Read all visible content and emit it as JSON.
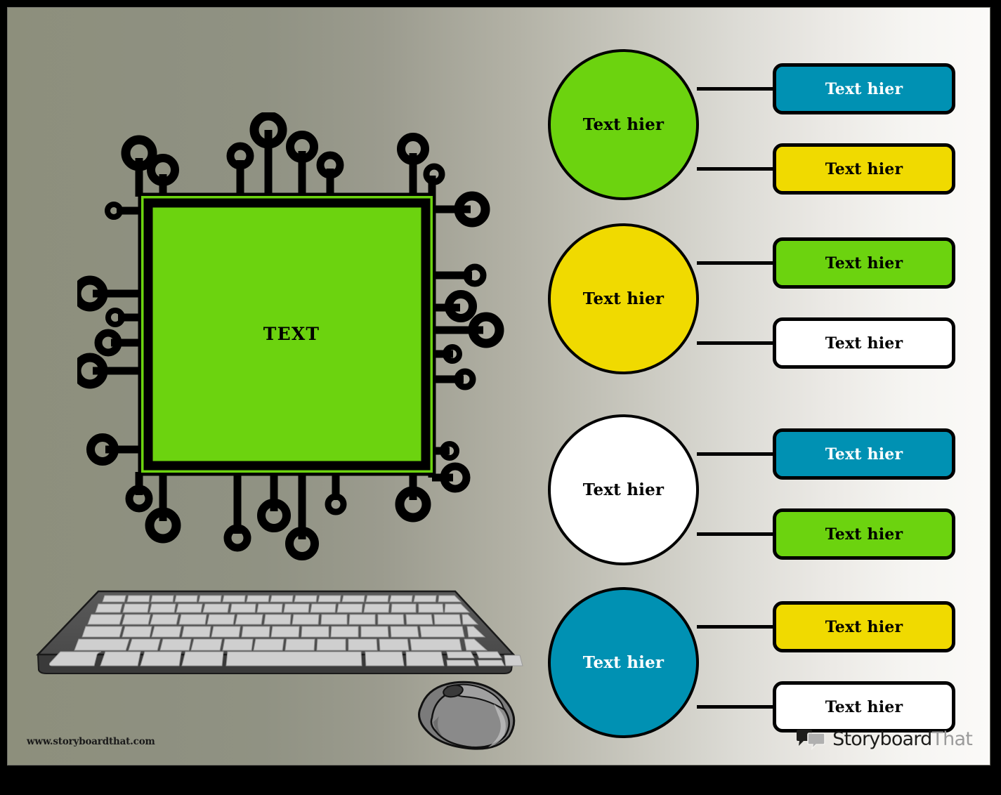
{
  "canvas": {
    "background_gradient_from": "#8d8f7c",
    "background_gradient_to": "#fbfaf8",
    "border_color": "#000000"
  },
  "palette": {
    "green": "#6CD30F",
    "yellow": "#F0DA00",
    "teal": "#0091B3",
    "white": "#FFFFFF",
    "outline": "#000000",
    "text_dark": "#000000",
    "text_light": "#FFFFFF"
  },
  "chip": {
    "label": "TEXT",
    "body_color": "#6CD30F",
    "pin_color": "#000000"
  },
  "devices": {
    "keyboard": "keyboard-illustration",
    "mouse": "mouse-illustration"
  },
  "groups": [
    {
      "circle": {
        "label": "Text hier",
        "fill": "#6CD30F",
        "text_color": "#000000"
      },
      "boxes": [
        {
          "label": "Text hier",
          "fill": "#0091B3",
          "text_color": "#FFFFFF"
        },
        {
          "label": "Text hier",
          "fill": "#F0DA00",
          "text_color": "#000000"
        }
      ]
    },
    {
      "circle": {
        "label": "Text hier",
        "fill": "#F0DA00",
        "text_color": "#000000"
      },
      "boxes": [
        {
          "label": "Text hier",
          "fill": "#6CD30F",
          "text_color": "#000000"
        },
        {
          "label": "Text hier",
          "fill": "#FFFFFF",
          "text_color": "#000000"
        }
      ]
    },
    {
      "circle": {
        "label": "Text hier",
        "fill": "#FFFFFF",
        "text_color": "#000000"
      },
      "boxes": [
        {
          "label": "Text hier",
          "fill": "#0091B3",
          "text_color": "#FFFFFF"
        },
        {
          "label": "Text hier",
          "fill": "#6CD30F",
          "text_color": "#000000"
        }
      ]
    },
    {
      "circle": {
        "label": "Text hier",
        "fill": "#0091B3",
        "text_color": "#FFFFFF"
      },
      "boxes": [
        {
          "label": "Text hier",
          "fill": "#F0DA00",
          "text_color": "#000000"
        },
        {
          "label": "Text hier",
          "fill": "#FFFFFF",
          "text_color": "#000000"
        }
      ]
    }
  ],
  "footer": {
    "watermark": "www.storyboardthat.com",
    "brand_primary": "Storyboard",
    "brand_secondary": "That"
  }
}
